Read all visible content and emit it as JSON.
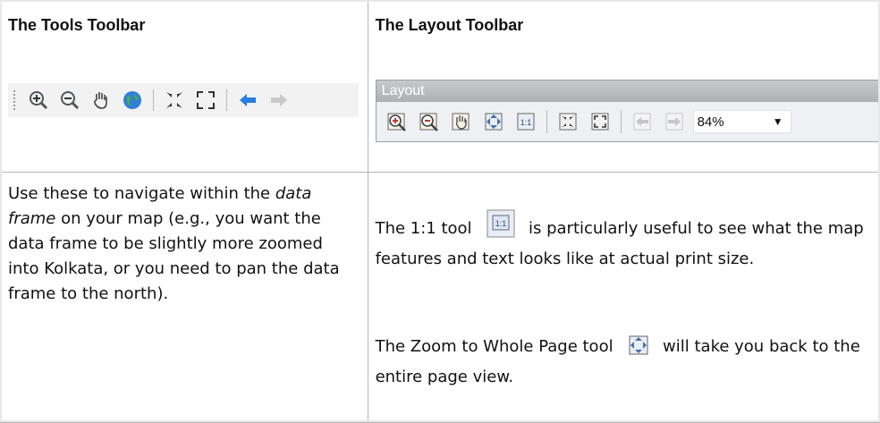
{
  "left_col": {
    "heading": "The Tools Toolbar",
    "toolbar_icons": [
      "zoom-in-icon",
      "zoom-out-icon",
      "pan-hand-icon",
      "globe-full-extent-icon",
      "fixed-zoom-in-icon",
      "fixed-zoom-out-icon",
      "back-arrow-icon",
      "forward-arrow-icon"
    ],
    "desc_before": "Use these to navigate within the ",
    "desc_italic": "data frame",
    "desc_after": " on your map (e.g., you want the data frame to be slightly more zoomed into Kolkata, or you need to pan the data frame to the north)."
  },
  "right_col": {
    "heading": "The Layout Toolbar",
    "window_title": "Layout",
    "zoom_value": "84%",
    "toolbar_icons": [
      "layout-zoom-in-icon",
      "layout-zoom-out-icon",
      "layout-pan-icon",
      "zoom-whole-page-icon",
      "zoom-100-percent-icon",
      "fixed-zoom-in-icon",
      "fixed-zoom-out-icon",
      "back-extent-icon",
      "forward-extent-icon"
    ],
    "p1_before": "The 1:1 tool ",
    "p1_after": " is particularly useful to see what the map features and text looks like at actual print size.",
    "p2_before": "The Zoom to Whole Page tool ",
    "p2_after": " will take you back to the entire page view."
  },
  "colors": {
    "grid_line": "#b5b5b5",
    "toolbar_bg": "#f2f2f2",
    "arrow_blue": "#2a7de1"
  }
}
